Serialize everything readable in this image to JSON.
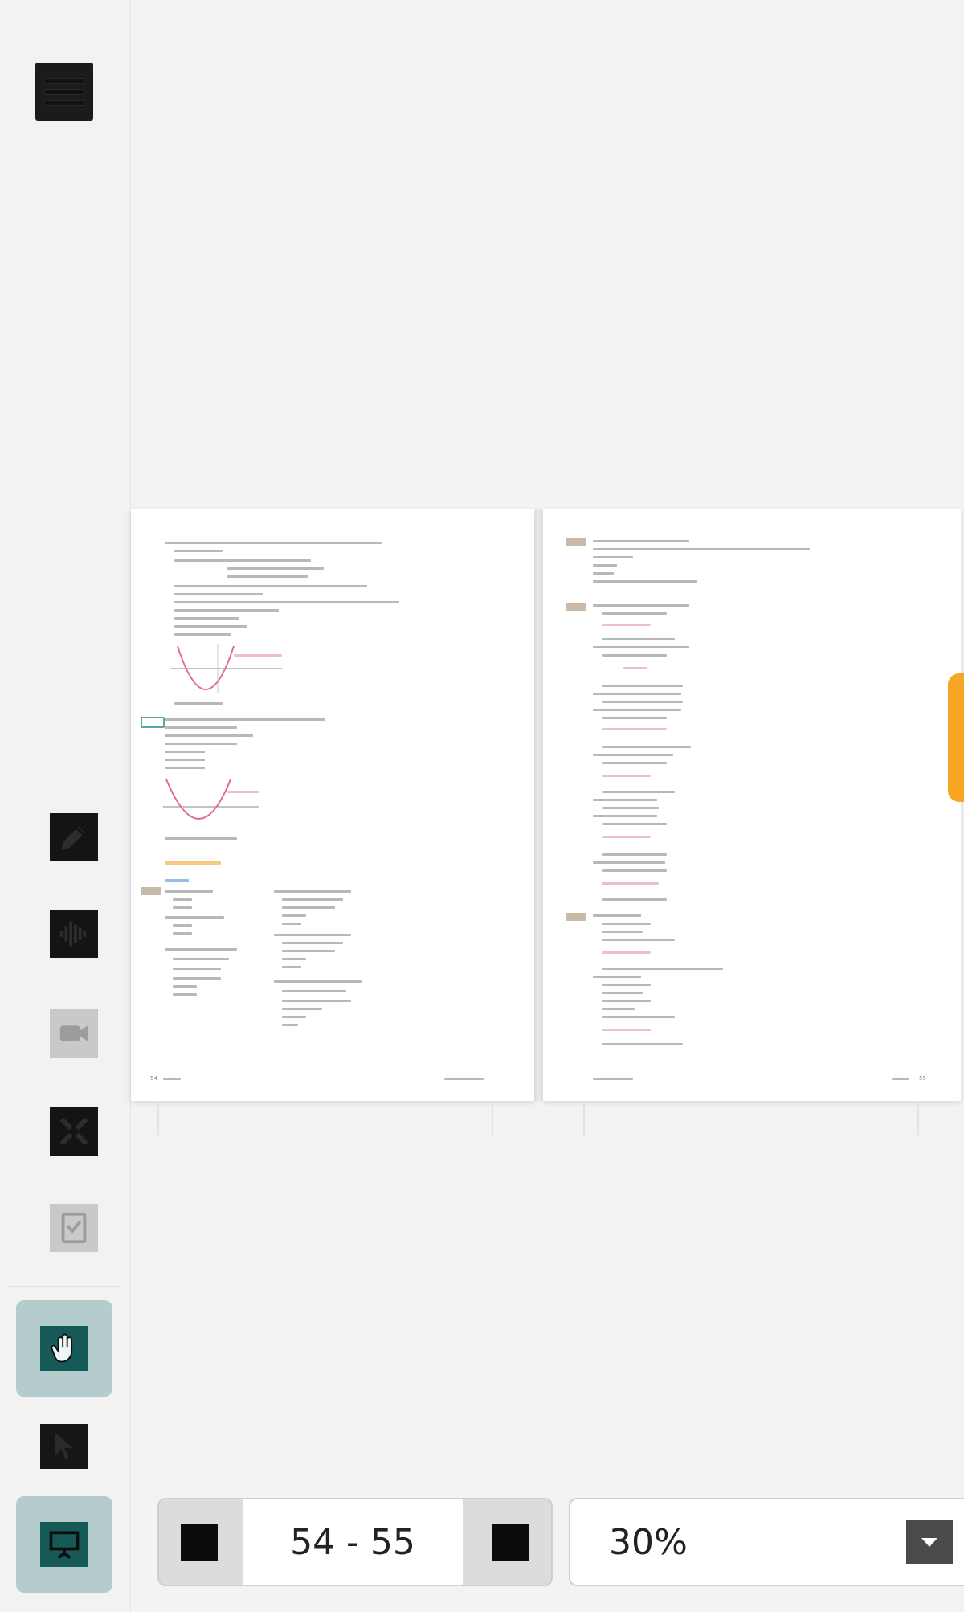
{
  "sidebar": {
    "menu_icon": "hamburger-menu-icon",
    "tools": [
      {
        "icon": "pencil-icon"
      },
      {
        "icon": "audio-wave-icon"
      },
      {
        "icon": "video-camera-icon"
      },
      {
        "icon": "tools-icon"
      },
      {
        "icon": "book-check-icon"
      }
    ],
    "modes": [
      {
        "icon": "hand-pan-icon",
        "active": true
      },
      {
        "icon": "cursor-select-icon",
        "active": false
      },
      {
        "icon": "presentation-icon",
        "active": true
      }
    ]
  },
  "document": {
    "left_page_number": "54",
    "right_page_number": "55",
    "section_heading": "Mixed Exercises",
    "sub_heading": "Page 84"
  },
  "pager": {
    "current_range": "54 - 55",
    "prev_icon": "prev-page-icon",
    "next_icon": "next-page-icon"
  },
  "zoom": {
    "value": "30%",
    "dropdown_icon": "chevron-down-icon"
  },
  "colors": {
    "accent_teal": "#155a56",
    "active_bg": "#b4cccc",
    "side_tab_orange": "#f6a623"
  }
}
